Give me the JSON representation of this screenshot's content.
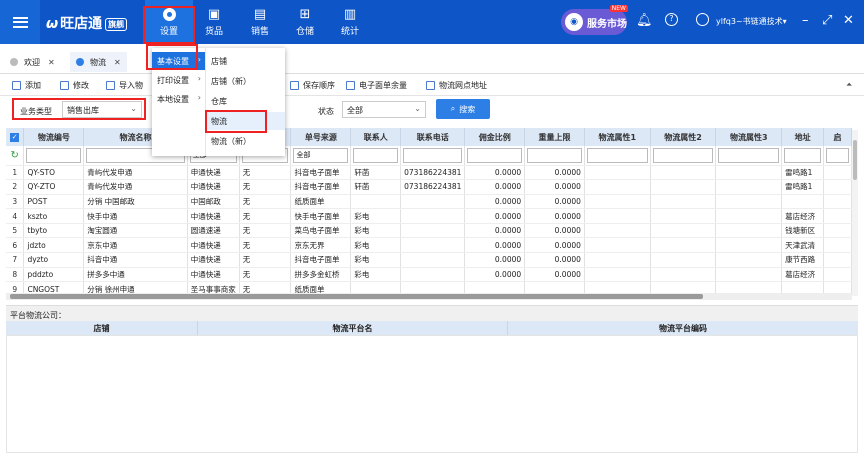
{
  "app": {
    "name": "旺店通",
    "edition": "旗舰"
  },
  "nav": {
    "settings": "设置",
    "goods": "货品",
    "sales": "销售",
    "warehouse": "仓储",
    "stats": "统计"
  },
  "service": {
    "label": "服务市场",
    "new": "NEW"
  },
  "user": {
    "name": "ylfq3~书链通技术▾"
  },
  "tabs": [
    {
      "label": "欢迎"
    },
    {
      "label": "物流"
    }
  ],
  "toolbar": {
    "add": "添加",
    "edit": "修改",
    "delete": "删除",
    "import": "导入物",
    "save_order": "保存顺序",
    "esheet": "电子面单余量",
    "outlet": "物流网点地址"
  },
  "filter": {
    "biz_label": "业务类型",
    "biz_value": "销售出库",
    "status_label": "状态",
    "status_value": "全部",
    "search": "搜索"
  },
  "menu": {
    "left": [
      {
        "label": "基本设置"
      },
      {
        "label": "打印设置"
      },
      {
        "label": "本地设置"
      }
    ],
    "right": [
      {
        "label": "店铺"
      },
      {
        "label": "店铺（新）"
      },
      {
        "label": "仓库"
      },
      {
        "label": "物流"
      },
      {
        "label": "物流（新）"
      }
    ]
  },
  "grid": {
    "columns": [
      "物流编号",
      "物流名称",
      "物",
      "寄件",
      "单号来源",
      "联系人",
      "联系电话",
      "佣金比例",
      "重量上限",
      "物流属性1",
      "物流属性2",
      "物流属性3",
      "地址",
      "启"
    ],
    "filter_all": "全部",
    "rows": [
      [
        "1",
        "QY-STO",
        "青屿代发申通",
        "申通快递",
        "无",
        "抖音电子面单",
        "轩菡",
        "073186224381",
        "0.0000",
        "0.0000",
        "",
        "",
        "",
        "雷鸣路1"
      ],
      [
        "2",
        "QY-ZTO",
        "青屿代发中通",
        "中通快递",
        "无",
        "抖音电子面单",
        "轩菡",
        "073186224381",
        "0.0000",
        "0.0000",
        "",
        "",
        "",
        "雷鸣路1"
      ],
      [
        "3",
        "POST",
        "分销 中国邮政",
        "中国邮政",
        "无",
        "纸质面单",
        "",
        "",
        "0.0000",
        "0.0000",
        "",
        "",
        "",
        ""
      ],
      [
        "4",
        "kszto",
        "快手中通",
        "中通快递",
        "无",
        "快手电子面单",
        "彩电",
        "",
        "0.0000",
        "0.0000",
        "",
        "",
        "",
        "葛店经济"
      ],
      [
        "5",
        "tbyto",
        "淘宝圆通",
        "圆通速递",
        "无",
        "菜鸟电子面单",
        "彩电",
        "",
        "0.0000",
        "0.0000",
        "",
        "",
        "",
        "钱塘新区"
      ],
      [
        "6",
        "jdzto",
        "京东中通",
        "中通快递",
        "无",
        "京东无界",
        "彩电",
        "",
        "0.0000",
        "0.0000",
        "",
        "",
        "",
        "天津武清"
      ],
      [
        "7",
        "dyzto",
        "抖音中通",
        "中通快递",
        "无",
        "抖音电子面单",
        "彩电",
        "",
        "0.0000",
        "0.0000",
        "",
        "",
        "",
        "康节西路"
      ],
      [
        "8",
        "pddzto",
        "拼多多中通",
        "中通快递",
        "无",
        "拼多多金虹桥",
        "彩电",
        "",
        "0.0000",
        "0.0000",
        "",
        "",
        "",
        "葛店经济"
      ],
      [
        "9",
        "CNGOST",
        "分销 徐州申通",
        "圣马事事商家",
        "无",
        "纸质面单",
        "",
        "",
        "",
        "",
        "",
        "",
        "",
        ""
      ]
    ]
  },
  "bottom": {
    "title": "平台物流公司：",
    "col_shop": "店铺",
    "col_name": "物流平台名",
    "col_code": "物流平台编码"
  },
  "colors": {
    "topbar": "#0e56c8",
    "accent": "#1e72e0",
    "highlight": "#ee2222"
  }
}
